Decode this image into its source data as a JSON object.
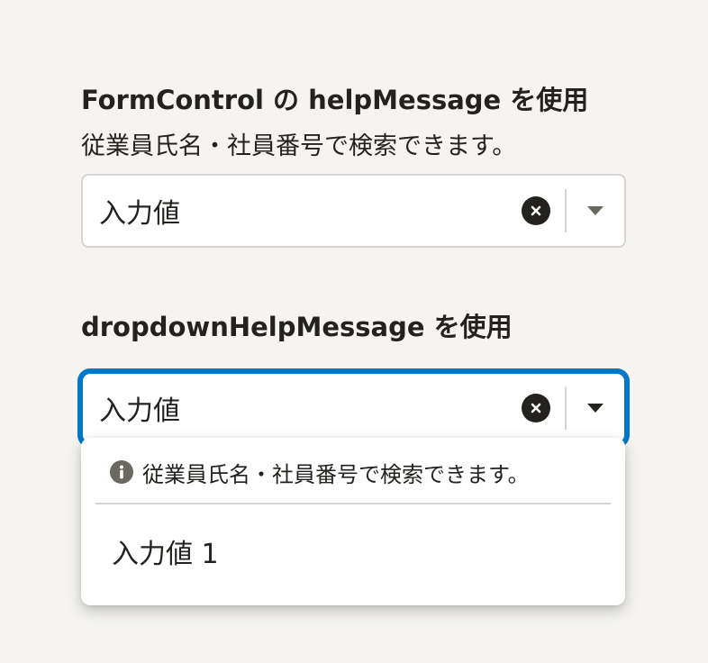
{
  "section1": {
    "title": "FormControl の helpMessage を使用",
    "help_message": "従業員氏名・社員番号で検索できます。",
    "combobox": {
      "value": "入力値"
    }
  },
  "section2": {
    "title": "dropdownHelpMessage を使用",
    "combobox": {
      "value": "入力値"
    },
    "dropdown": {
      "help_message": "従業員氏名・社員番号で検索できます。",
      "options": [
        {
          "label": "入力値 1"
        }
      ]
    }
  },
  "colors": {
    "background": "#f5f4f1",
    "text": "#23221e",
    "border": "#d6d3d0",
    "focus": "#0077c7",
    "info_icon": "#6b6862"
  },
  "icons": {
    "clear": "close-circle-icon",
    "caret": "caret-down-icon",
    "info": "info-circle-icon"
  }
}
